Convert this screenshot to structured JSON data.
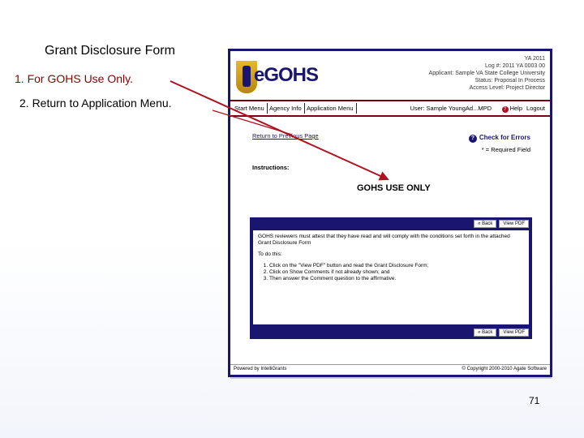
{
  "slide": {
    "title": "Grant Disclosure Form",
    "bullet1": "1.   For GOHS Use Only.",
    "bullet2": "2.   Return to Application Menu.",
    "page_number": "71"
  },
  "app": {
    "logo": "eGOHS",
    "header_info": [
      "YA 2011",
      "Log #: 2011 YA 0003 00",
      "Applicant: Sample VA State College University",
      "Status: Proposal In Process",
      "Access Level: Project Director"
    ],
    "nav": [
      "Start Menu",
      "Agency Info",
      "Application Menu"
    ],
    "user": "User: Sample YoungAd...MPD",
    "help": "Help",
    "logout": "Logout",
    "return_link": "Return to Previous Page",
    "check_errors": "Check for Errors",
    "required_field": "* = Required Field",
    "instructions": "Instructions:",
    "section_title": "GOHS USE ONLY",
    "back_label": "Back",
    "view_pdf_label": "View PDF",
    "para1": "GOHS reviewers must attest that they have read and will comply with the conditions set forth in the attached Grant Disclosure Form",
    "todo": "To do this:",
    "steps": [
      "Click on the \"View PDF\" button and read the Grant Disclosure Form;",
      "Click on Show Comments if not already shown; and",
      "Then answer the Comment question to the affirmative."
    ],
    "footer_left": "Powered by IntelliGrants",
    "footer_right": "© Copyright 2000-2010 Agate Software"
  },
  "colors": {
    "navy": "#1a1670",
    "maroon": "#7a0010",
    "arrow": "#b01020"
  }
}
